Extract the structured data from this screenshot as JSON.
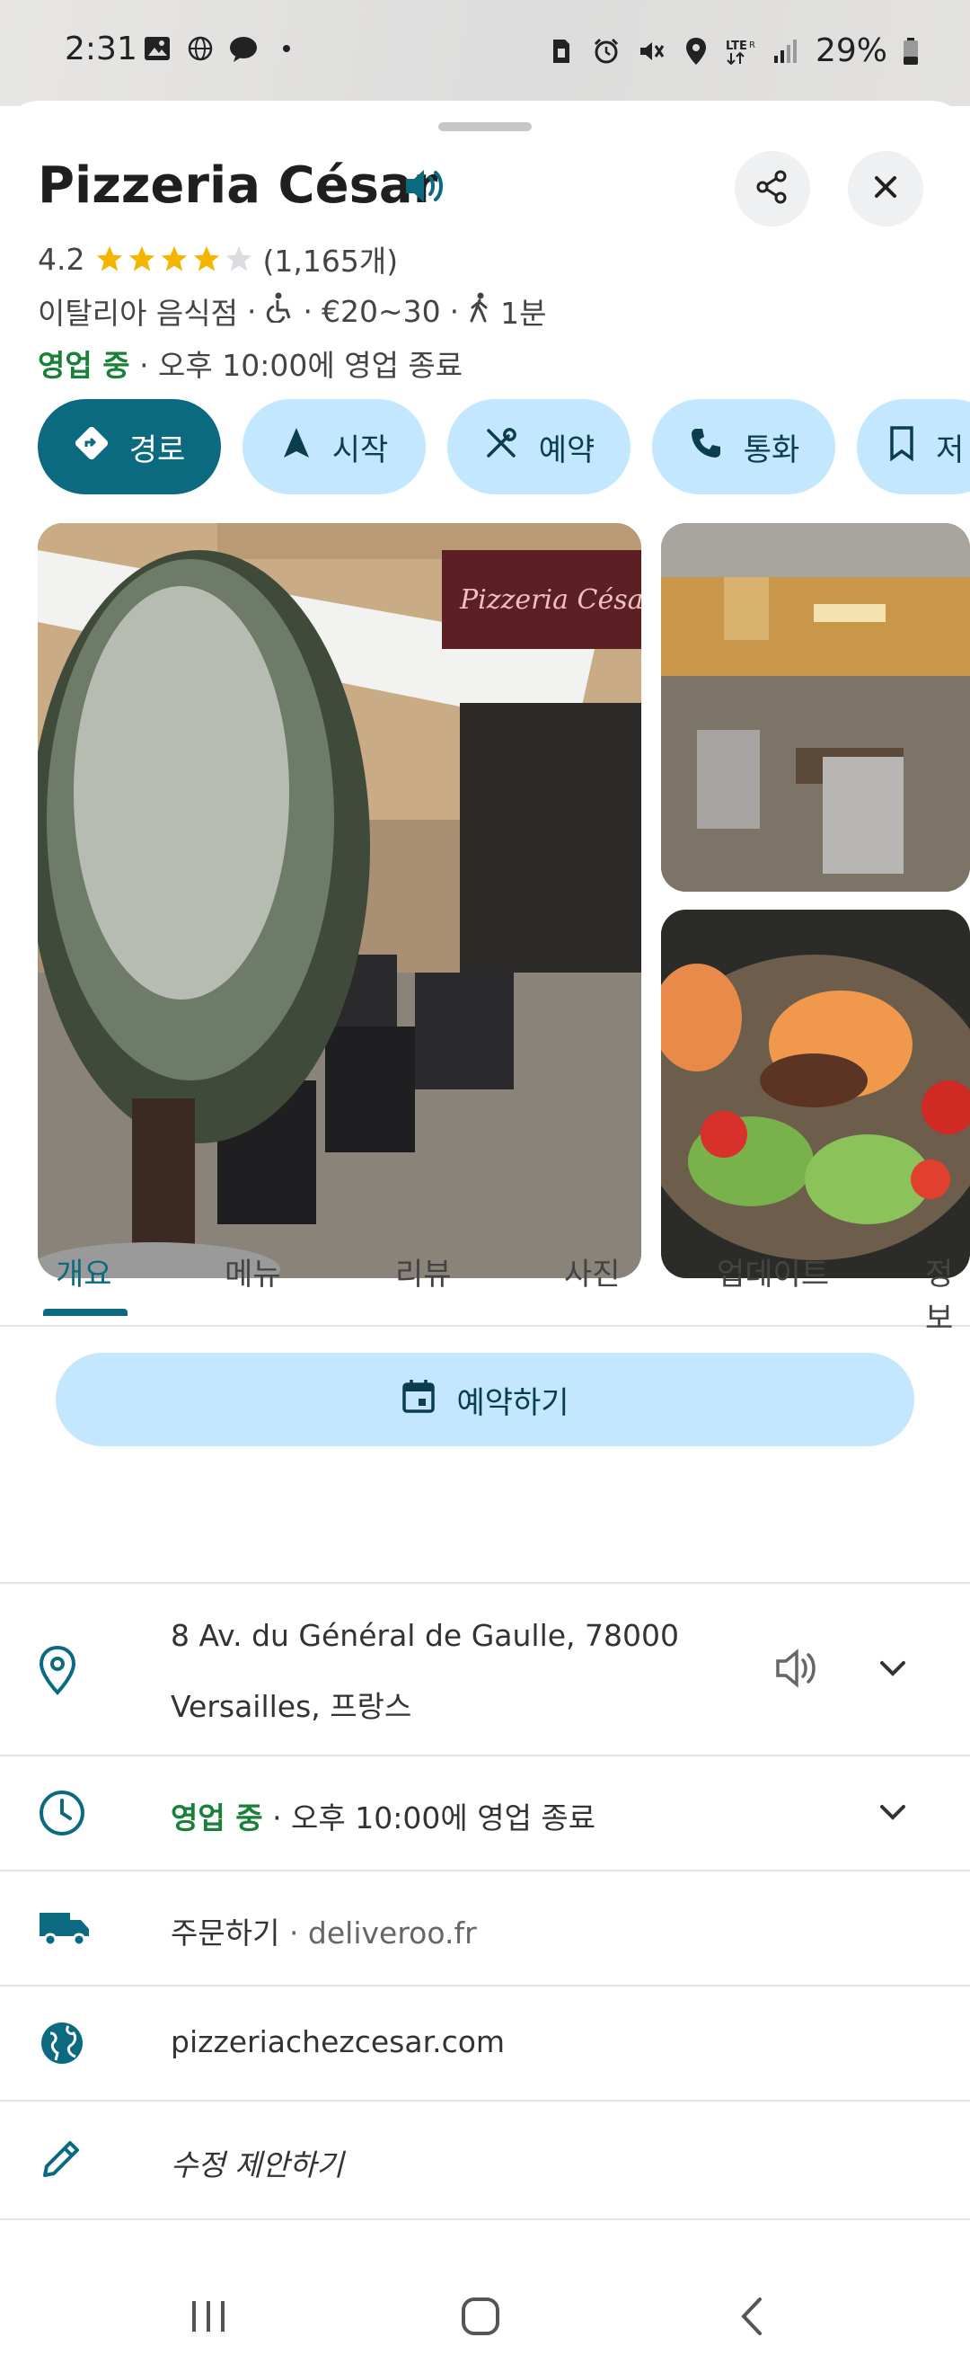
{
  "status_bar": {
    "time": "2:31",
    "battery_percent": "29%",
    "icons_left": [
      "gallery-icon",
      "globe-icon",
      "messenger-icon",
      "dot-icon"
    ],
    "icons_right": [
      "sim-icon",
      "alarm-icon",
      "mute-icon",
      "location-icon",
      "lte-icon",
      "signal-icon",
      "battery-icon"
    ]
  },
  "place": {
    "name": "Pizzeria César",
    "rating": "4.2",
    "stars_filled": 4,
    "review_count": "(1,165개)",
    "category": "이탈리아 음식점",
    "separator": "·",
    "price": "€20~30",
    "walk_time": "1분",
    "open_status": "영업 중",
    "close_info": "· 오후 10:00에 영업 종료"
  },
  "actions": [
    {
      "label": "경로",
      "icon": "directions-icon"
    },
    {
      "label": "시작",
      "icon": "navigation-icon"
    },
    {
      "label": "예약",
      "icon": "cutlery-icon"
    },
    {
      "label": "통화",
      "icon": "phone-icon"
    },
    {
      "label": "저",
      "icon": "bookmark-icon"
    }
  ],
  "photo_sign": "Pizzeria César",
  "tabs": [
    "개요",
    "메뉴",
    "리뷰",
    "사진",
    "업데이트",
    "정보"
  ],
  "reserve_button": "예약하기",
  "details": {
    "address_line1": "8 Av. du Général de Gaulle, 78000",
    "address_line2": "Versailles, 프랑스",
    "hours_status": "영업 중",
    "hours_info": " · 오후 10:00에 영업 종료",
    "order_label": "주문하기",
    "order_site": " · deliveroo.fr",
    "website": "pizzeriachezcesar.com",
    "suggest_edit": "수정 제안하기"
  },
  "colors": {
    "accent": "#0b6a80",
    "chip_bg": "#c2e7ff",
    "open_green": "#188038",
    "star": "#f4b400"
  }
}
